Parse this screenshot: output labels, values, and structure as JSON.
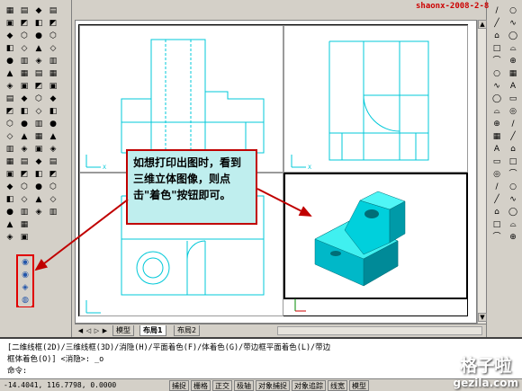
{
  "stamp": "shaonx-2008-2-8",
  "callout": {
    "text": "如想打印出图时，看到三维立体图像，则点击\"着色\"按钮即可。"
  },
  "layout_tabs": [
    {
      "label": "模型",
      "active": false
    },
    {
      "label": "布局1",
      "active": true
    },
    {
      "label": "布局2",
      "active": false
    }
  ],
  "command_lines": [
    "[二维线框(2D)/三维线框(3D)/消隐(H)/平面着色(F)/体着色(G)/带边框平面着色(L)/带边",
    "框体着色(O)] <消隐>: _o",
    "命令:"
  ],
  "status": {
    "coords": "-14.4041, 116.7798, 0.0000",
    "buttons": [
      "捕捉",
      "栅格",
      "正交",
      "极轴",
      "对象捕捉",
      "对象追踪",
      "线宽",
      "模型"
    ]
  },
  "watermark": {
    "line1": "格子啦",
    "line2": "gezila.com"
  },
  "colors": {
    "accent": "#c00000",
    "callout_bg": "#bfeeee",
    "drawing_lines": "#00c8d8",
    "solid": "#00e0e0"
  }
}
